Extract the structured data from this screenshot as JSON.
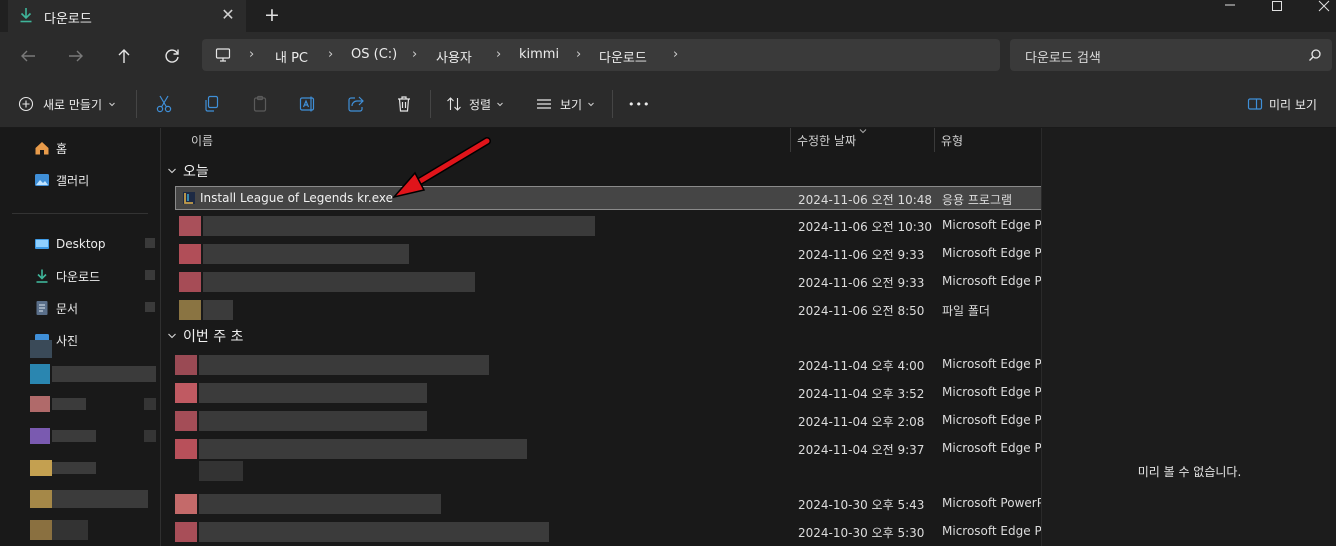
{
  "window": {
    "tab_title": "다운로드",
    "tab_close": "✕",
    "new_tab": "+"
  },
  "nav": {
    "breadcrumb": [
      "내 PC",
      "OS (C:)",
      "사용자",
      "kimmi",
      "다운로드"
    ],
    "search_placeholder": "다운로드 검색"
  },
  "toolbar": {
    "new_label": "새로 만들기",
    "sort_label": "정렬",
    "view_label": "보기",
    "more": "•••",
    "preview_label": "미리 보기"
  },
  "sidebar": {
    "items": [
      {
        "label": "홈",
        "icon": "home-icon"
      },
      {
        "label": "갤러리",
        "icon": "gallery-icon"
      },
      {
        "label": "Desktop",
        "icon": "desktop-icon"
      },
      {
        "label": "다운로드",
        "icon": "download-icon"
      },
      {
        "label": "문서",
        "icon": "document-icon"
      },
      {
        "label": "사진",
        "icon": "pictures-icon"
      }
    ]
  },
  "columns": {
    "name": "이름",
    "modified": "수정한 날짜",
    "type": "유형"
  },
  "groups": {
    "today": "오늘",
    "this_week": "이번 주 초"
  },
  "files": [
    {
      "name": "Install League of Legends kr.exe",
      "date": "2024-11-06 오전 10:48",
      "type": "응용 프로그램"
    },
    {
      "name": "",
      "date": "2024-11-06 오전 10:30",
      "type": "Microsoft Edge P..."
    },
    {
      "name": "",
      "date": "2024-11-06 오전 9:33",
      "type": "Microsoft Edge P..."
    },
    {
      "name": "",
      "date": "2024-11-06 오전 9:33",
      "type": "Microsoft Edge P..."
    },
    {
      "name": "",
      "date": "2024-11-06 오전 8:50",
      "type": "파일 폴더"
    },
    {
      "name": "",
      "date": "2024-11-04 오후 4:00",
      "type": "Microsoft Edge P..."
    },
    {
      "name": "",
      "date": "2024-11-04 오후 3:52",
      "type": "Microsoft Edge P..."
    },
    {
      "name": "",
      "date": "2024-11-04 오후 2:08",
      "type": "Microsoft Edge P..."
    },
    {
      "name": "",
      "date": "2024-11-04 오전 9:37",
      "type": "Microsoft Edge P..."
    },
    {
      "name": "",
      "date": "2024-10-30 오후 5:43",
      "type": "Microsoft PowerP..."
    },
    {
      "name": "",
      "date": "2024-10-30 오후 5:30",
      "type": "Microsoft Edge P..."
    }
  ],
  "preview": {
    "empty_text": "미리 볼 수 없습니다."
  },
  "colors": {
    "accent_download": "#3fb59a",
    "annotation_arrow": "#e0141a"
  }
}
